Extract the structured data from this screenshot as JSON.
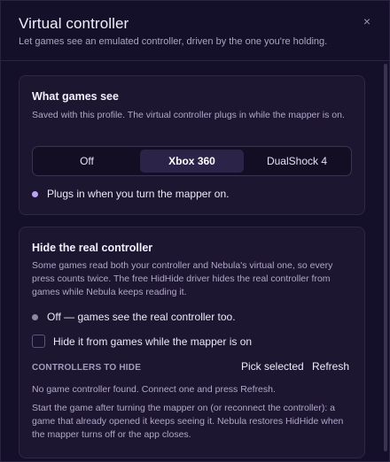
{
  "dialog": {
    "title": "Virtual controller",
    "subtitle": "Let games see an emulated controller, driven by the one you're holding.",
    "close_glyph": "×"
  },
  "what_games_see": {
    "title": "What games see",
    "description": "Saved with this profile. The virtual controller plugs in while the mapper is on.",
    "options": [
      "Off",
      "Xbox 360",
      "DualShock 4"
    ],
    "selected": "Xbox 360",
    "status": "Plugs in when you turn the mapper on."
  },
  "hide_real": {
    "title": "Hide the real controller",
    "description": "Some games read both your controller and Nebula's virtual one, so every press counts twice. The free HidHide driver hides the real controller from games while Nebula keeps reading it.",
    "status": "Off — games see the real controller too.",
    "checkbox_label": "Hide it from games while the mapper is on",
    "checkbox_checked": false,
    "controllers_label": "CONTROLLERS TO HIDE",
    "pick_selected_label": "Pick selected",
    "refresh_label": "Refresh",
    "empty_message": "No game controller found. Connect one and press Refresh.",
    "footnote": "Start the game after turning the mapper on (or reconnect the controller): a game that already opened it keeps seeing it. Nebula restores HidHide when the mapper turns off or the app closes."
  },
  "colors": {
    "background": "#15102a",
    "card": "#1c1631",
    "accent_dot": "#b9a4f4",
    "selected_segment": "#2c2448"
  },
  "icons": {
    "close": "close-icon",
    "status_on": "status-dot-icon",
    "status_off": "status-dot-icon"
  }
}
